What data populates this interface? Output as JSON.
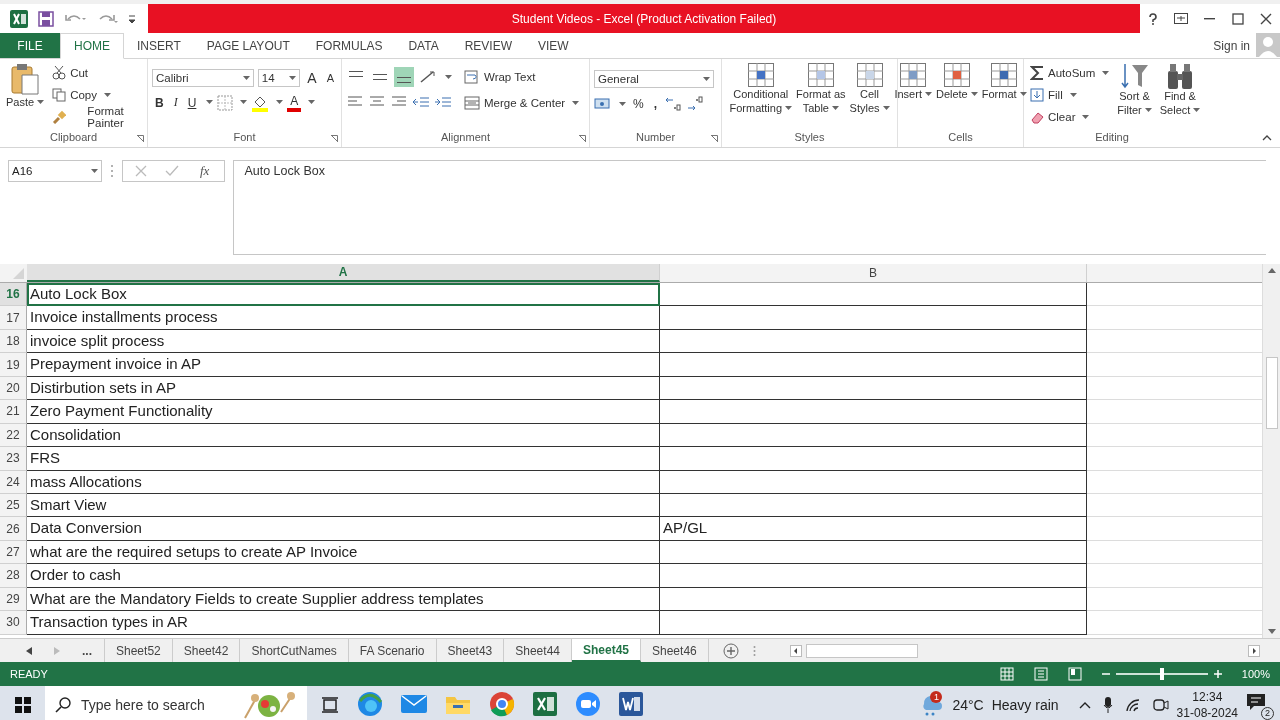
{
  "title_bar": {
    "title": "Student Videos -  Excel (Product Activation Failed)"
  },
  "ribbon_tabs": [
    {
      "label": "FILE",
      "kind": "file",
      "selected": false
    },
    {
      "label": "HOME",
      "kind": "tab",
      "selected": true
    },
    {
      "label": "INSERT",
      "kind": "tab",
      "selected": false
    },
    {
      "label": "PAGE LAYOUT",
      "kind": "tab",
      "selected": false
    },
    {
      "label": "FORMULAS",
      "kind": "tab",
      "selected": false
    },
    {
      "label": "DATA",
      "kind": "tab",
      "selected": false
    },
    {
      "label": "REVIEW",
      "kind": "tab",
      "selected": false
    },
    {
      "label": "VIEW",
      "kind": "tab",
      "selected": false
    }
  ],
  "account": {
    "label": "Sign in"
  },
  "clipboard": {
    "label": "Clipboard",
    "paste": "Paste",
    "cut": "Cut",
    "copy": "Copy",
    "format_painter": "Format Painter"
  },
  "font": {
    "label": "Font",
    "name": "Calibri",
    "size": "14",
    "grow": "A",
    "shrink": "A",
    "bold": "B",
    "italic": "I",
    "underline": "U",
    "color_letter": "A"
  },
  "alignment": {
    "label": "Alignment",
    "wrap": "Wrap Text",
    "merge": "Merge & Center",
    "bottom_align_on": true
  },
  "number": {
    "label": "Number",
    "format": "General",
    "percent": "%",
    "comma": ","
  },
  "styles": {
    "label": "Styles",
    "buttons": [
      {
        "lines": [
          "Conditional",
          "Formatting"
        ]
      },
      {
        "lines": [
          "Format as",
          "Table"
        ]
      },
      {
        "lines": [
          "Cell",
          "Styles"
        ]
      }
    ]
  },
  "cells": {
    "label": "Cells",
    "buttons": [
      {
        "lines": [
          "Insert"
        ]
      },
      {
        "lines": [
          "Delete"
        ]
      },
      {
        "lines": [
          "Format"
        ]
      }
    ]
  },
  "editing": {
    "label": "Editing",
    "autosum": "AutoSum",
    "fill": "Fill",
    "clear": "Clear",
    "buttons": [
      {
        "lines": [
          "Sort &",
          "Filter"
        ]
      },
      {
        "lines": [
          "Find &",
          "Select"
        ]
      }
    ]
  },
  "formula_bar": {
    "name_box": "A16",
    "function_label": "fx",
    "formula": "Auto Lock Box"
  },
  "sheet": {
    "columns": [
      {
        "label": "A",
        "selected": true
      },
      {
        "label": "B",
        "selected": false
      }
    ],
    "rows": [
      {
        "number": "16",
        "a": "Auto Lock Box",
        "selected": true
      },
      {
        "number": "17",
        "a": "Invoice installments process",
        "selected": false
      },
      {
        "number": "18",
        "a": "invoice split process",
        "selected": false
      },
      {
        "number": "19",
        "a": "Prepayment invoice in AP",
        "selected": false
      },
      {
        "number": "20",
        "a": "Distirbution sets in AP",
        "selected": false
      },
      {
        "number": "21",
        "a": "Zero Payment Functionality",
        "selected": false
      },
      {
        "number": "22",
        "a": "Consolidation",
        "selected": false
      },
      {
        "number": "23",
        "a": "FRS",
        "selected": false
      },
      {
        "number": "24",
        "a": "mass Allocations",
        "selected": false
      },
      {
        "number": "25",
        "a": "Smart View",
        "selected": false
      },
      {
        "number": "26",
        "a": "Data Conversion",
        "b": "AP/GL",
        "selected": false
      },
      {
        "number": "27",
        "a": "what are the required setups to create AP Invoice",
        "selected": false
      },
      {
        "number": "28",
        "a": "Order to cash",
        "selected": false
      },
      {
        "number": "29",
        "a": "What are the Mandatory Fields to create Supplier address templates",
        "selected": false
      },
      {
        "number": "30",
        "a": "Transaction types in AR",
        "selected": false
      }
    ]
  },
  "sheet_tabs": {
    "more": "...",
    "tabs": [
      {
        "label": "Sheet52",
        "selected": false
      },
      {
        "label": "Sheet42",
        "selected": false
      },
      {
        "label": "ShortCutNames",
        "selected": false
      },
      {
        "label": "FA Scenario",
        "selected": false
      },
      {
        "label": "Sheet43",
        "selected": false
      },
      {
        "label": "Sheet44",
        "selected": false
      },
      {
        "label": "Sheet45",
        "selected": true
      },
      {
        "label": "Sheet46",
        "selected": false
      }
    ]
  },
  "status_bar": {
    "status": "READY",
    "zoom": {
      "level": 0.5,
      "reading": "100%"
    }
  },
  "taskbar": {
    "search_placeholder": "Type here to search",
    "weather": {
      "badge": "1",
      "temperature": "24°C",
      "condition": "Heavy rain"
    },
    "time": "12:34",
    "date": "31-08-2024",
    "notifications": "2"
  }
}
